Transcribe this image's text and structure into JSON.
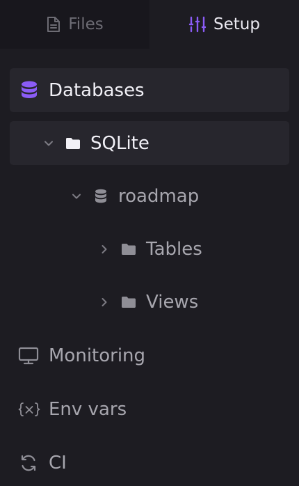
{
  "tabs": [
    {
      "label": "Files",
      "icon": "file-icon",
      "active": false
    },
    {
      "label": "Setup",
      "icon": "sliders-icon",
      "active": true
    }
  ],
  "tree": {
    "databases": {
      "label": "Databases",
      "icon": "database-icon"
    },
    "sqlite": {
      "label": "SQLite",
      "icon": "folder-icon",
      "expanded": true
    },
    "roadmap": {
      "label": "roadmap",
      "icon": "database-icon",
      "expanded": true
    },
    "tables": {
      "label": "Tables",
      "icon": "folder-icon",
      "expanded": false
    },
    "views": {
      "label": "Views",
      "icon": "folder-icon",
      "expanded": false
    }
  },
  "nav": [
    {
      "label": "Monitoring",
      "icon": "monitor-icon"
    },
    {
      "label": "Env vars",
      "icon": "variable-icon"
    },
    {
      "label": "CI",
      "icon": "refresh-icon"
    }
  ],
  "colors": {
    "background": "#1d1c22",
    "accent": "#8b5cf6",
    "active_row": "#27262d",
    "text_muted": "#a7a6ae",
    "text_bright": "#eceaf2"
  }
}
